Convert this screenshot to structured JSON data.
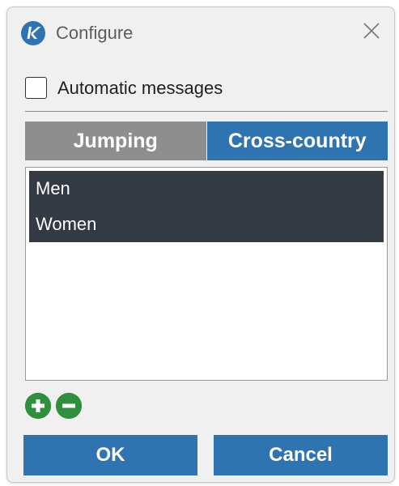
{
  "window": {
    "title": "Configure",
    "icon": "k-logo-icon",
    "close_icon": "close-icon"
  },
  "options": {
    "automatic_messages_label": "Automatic messages",
    "automatic_messages_checked": false
  },
  "tabs": [
    {
      "label": "Jumping",
      "active": false
    },
    {
      "label": "Cross-country",
      "active": true
    }
  ],
  "list": {
    "items": [
      {
        "label": "Men",
        "selected": true
      },
      {
        "label": "Women",
        "selected": true
      }
    ]
  },
  "list_actions": {
    "add_icon": "plus-circle-icon",
    "remove_icon": "minus-circle-icon"
  },
  "buttons": {
    "ok_label": "OK",
    "cancel_label": "Cancel"
  },
  "colors": {
    "accent": "#2f73b0",
    "inactive_tab": "#8e8e8e",
    "selection": "#343a43",
    "action_green": "#2f8f3c"
  }
}
